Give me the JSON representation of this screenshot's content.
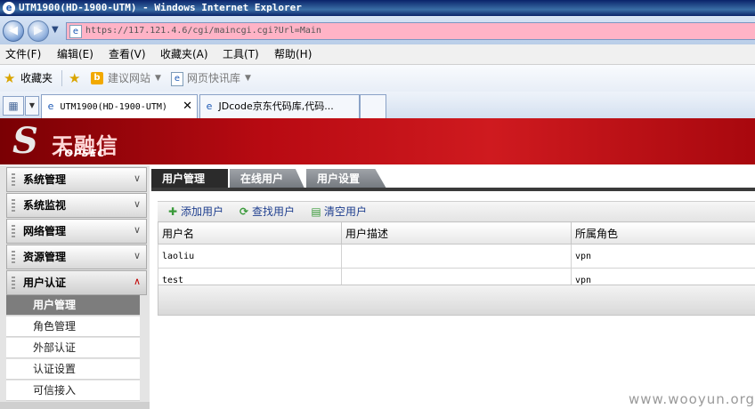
{
  "window": {
    "title": "UTM1900(HD-1900-UTM) - Windows Internet Explorer"
  },
  "browser": {
    "address_url": "https://117.121.4.6/cgi/maincgi.cgi?Url=Main",
    "menu": [
      "文件(F)",
      "编辑(E)",
      "查看(V)",
      "收藏夹(A)",
      "工具(T)",
      "帮助(H)"
    ],
    "favorites": {
      "label": "收藏夹",
      "items": [
        "建议网站",
        "网页快讯库"
      ]
    },
    "tabs": [
      "UTM1900(HD-1900-UTM)",
      "JDcode京东代码库,代码..."
    ]
  },
  "banner": {
    "logo_cn": "天融信",
    "logo_en": "TOPSEC"
  },
  "sidebar": {
    "sections": [
      {
        "label": "系统管理",
        "state": "collapsed"
      },
      {
        "label": "系统监视",
        "state": "collapsed"
      },
      {
        "label": "网络管理",
        "state": "collapsed"
      },
      {
        "label": "资源管理",
        "state": "collapsed"
      },
      {
        "label": "用户认证",
        "state": "expanded"
      }
    ],
    "subitems": [
      {
        "label": "用户管理",
        "active": true
      },
      {
        "label": "角色管理",
        "active": false
      },
      {
        "label": "外部认证",
        "active": false
      },
      {
        "label": "认证设置",
        "active": false
      },
      {
        "label": "可信接入",
        "active": false
      }
    ]
  },
  "content": {
    "tabs": [
      "用户管理",
      "在线用户",
      "用户设置"
    ],
    "toolbar": [
      "添加用户",
      "查找用户",
      "清空用户"
    ],
    "table": {
      "columns": [
        "用户名",
        "用户描述",
        "所属角色"
      ],
      "rows": [
        [
          "laoliu",
          "",
          "vpn"
        ],
        [
          "test",
          "",
          "vpn"
        ]
      ]
    }
  },
  "watermark": "www.wooyun.org",
  "colors": {
    "brand_red": "#c8141a",
    "active_tab": "#2b2b2b"
  }
}
